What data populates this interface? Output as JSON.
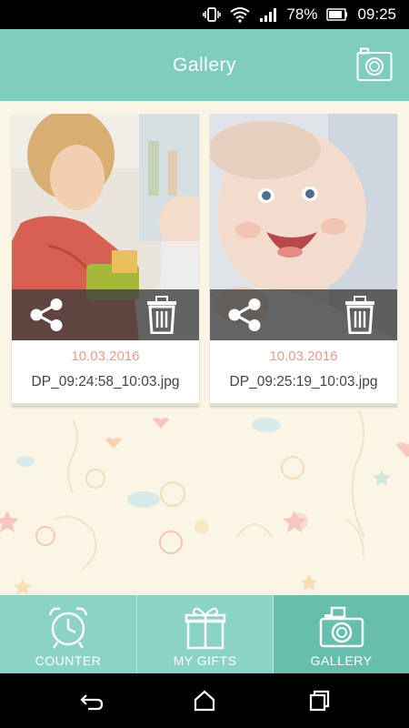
{
  "status_bar": {
    "battery_percent": "78%",
    "time": "09:25",
    "icons": [
      "vibrate-icon",
      "wifi-icon",
      "signal-icon",
      "battery-icon"
    ]
  },
  "header": {
    "title": "Gallery",
    "camera_icon": "camera-icon"
  },
  "gallery": {
    "items": [
      {
        "date": "10.03.2016",
        "filename": "DP_09:24:58_10:03.jpg",
        "share_icon": "share-icon",
        "delete_icon": "trash-icon"
      },
      {
        "date": "10.03.2016",
        "filename": "DP_09:25:19_10:03.jpg",
        "share_icon": "share-icon",
        "delete_icon": "trash-icon"
      }
    ]
  },
  "tabs": [
    {
      "label": "COUNTER",
      "icon": "alarm-clock-icon",
      "active": false
    },
    {
      "label": "MY GIFTS",
      "icon": "gift-icon",
      "active": false
    },
    {
      "label": "GALLERY",
      "icon": "camera-icon",
      "active": true
    }
  ],
  "nav_bar": {
    "icons": [
      "back-icon",
      "home-icon",
      "recents-icon"
    ]
  },
  "colors": {
    "header": "#7fcdbf",
    "tab_bar": "#8ad3c6",
    "tab_active": "#66bfad",
    "date_text": "#ee9a8b",
    "background": "#fbf5e6"
  }
}
